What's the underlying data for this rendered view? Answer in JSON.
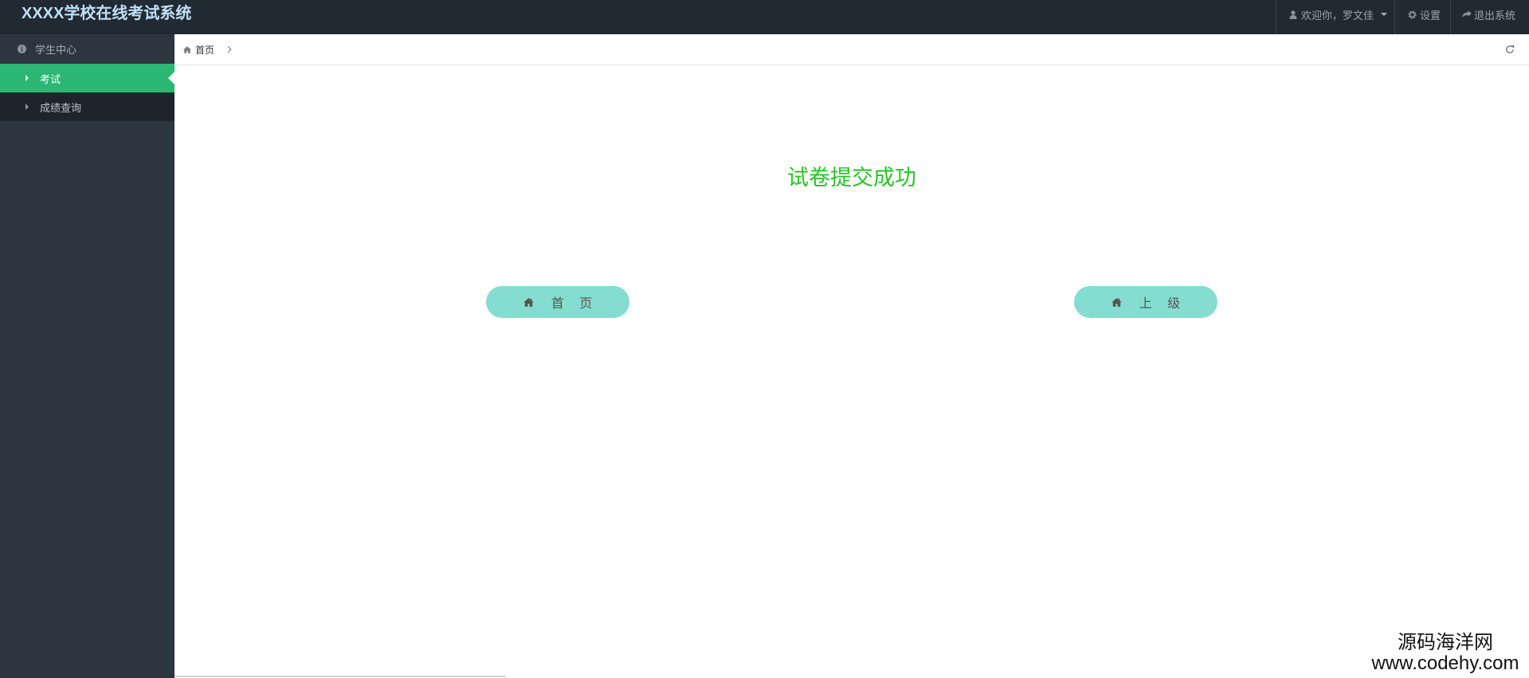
{
  "header": {
    "title": "XXXX学校在线考试系统",
    "user_menu": {
      "icon": "user-icon",
      "welcome": "欢迎你，罗文佳",
      "caret_icon": "caret-down-icon"
    },
    "settings": {
      "icon": "gear-icon",
      "label": "设置"
    },
    "logout": {
      "icon": "share-icon",
      "label": "退出系统"
    }
  },
  "sidebar": {
    "section": {
      "icon": "info-icon",
      "label": "学生中心"
    },
    "items": [
      {
        "icon": "caret-right-icon",
        "label": "考试",
        "active": true
      },
      {
        "icon": "caret-right-icon",
        "label": "成绩查询",
        "active": false
      }
    ]
  },
  "breadcrumb": {
    "items": [
      {
        "icon": "home-icon",
        "label": "首页"
      }
    ],
    "separator_icon": "chevron-right-icon",
    "refresh_icon": "refresh-icon"
  },
  "main": {
    "message": "试卷提交成功",
    "buttons": [
      {
        "icon": "home-icon",
        "label": "首 页"
      },
      {
        "icon": "home-icon",
        "label": "上 级"
      }
    ]
  },
  "watermark": {
    "name": "源码海洋网",
    "url": "www.codehy.com"
  },
  "colors": {
    "header_bg": "#212932",
    "title": "#bfe0f5",
    "sidebar_bg": "#2d3540",
    "sidebar_item_bg": "#1e242b",
    "active_item_bg": "#2bb673",
    "message": "#26c426",
    "button_bg": "#84ddd0"
  }
}
